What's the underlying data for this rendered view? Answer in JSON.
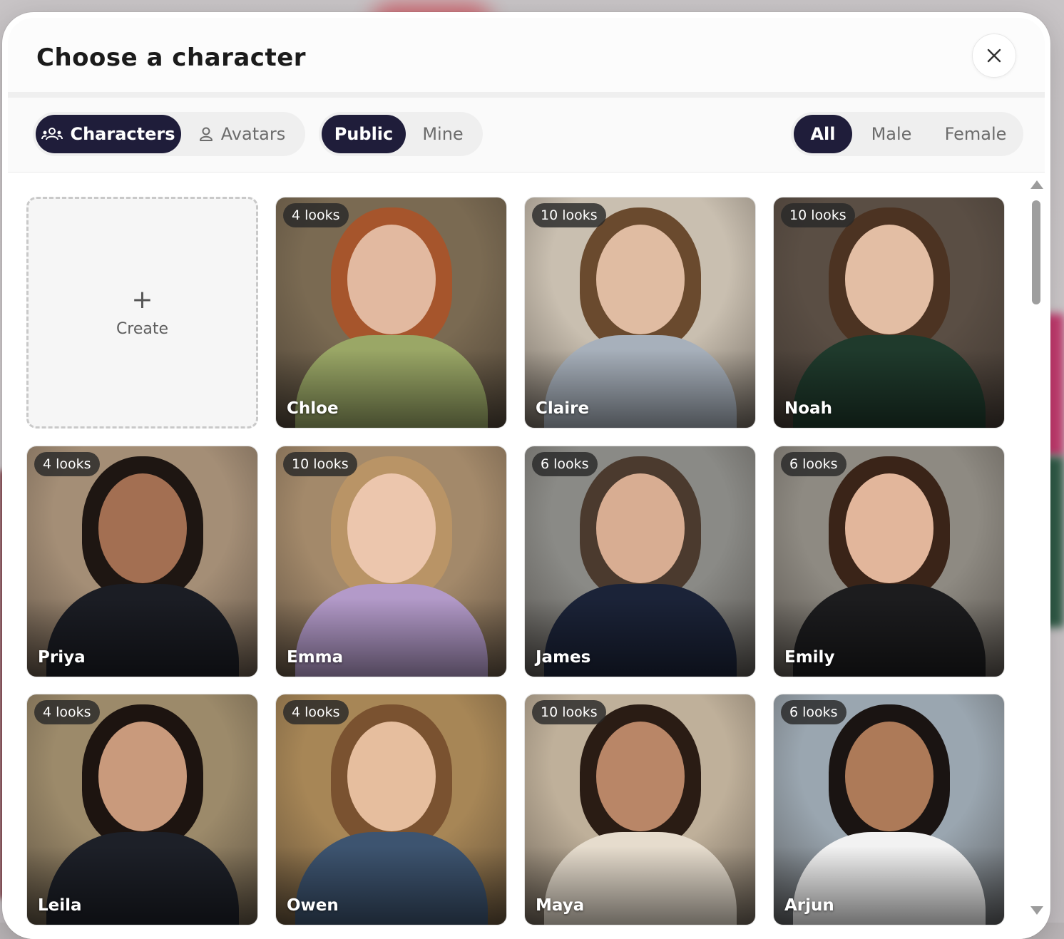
{
  "dialog": {
    "title": "Choose a character",
    "close_icon": "close-icon"
  },
  "type_tabs": [
    {
      "label": "Characters",
      "icon": "group-icon",
      "active": true
    },
    {
      "label": "Avatars",
      "icon": "person-icon",
      "active": false
    }
  ],
  "visibility_tabs": [
    {
      "label": "Public",
      "active": true
    },
    {
      "label": "Mine",
      "active": false
    }
  ],
  "gender_tabs": [
    {
      "label": "All",
      "active": true
    },
    {
      "label": "Male",
      "active": false
    },
    {
      "label": "Female",
      "active": false
    }
  ],
  "create_card": {
    "label": "Create",
    "icon": "plus-icon",
    "plus_glyph": "+"
  },
  "characters": [
    {
      "name": "Chloe",
      "looks": "4 looks",
      "bg": "#7a6a52",
      "skin": "#e2b9a0",
      "hair": "#a6552c",
      "top": "#9aa766"
    },
    {
      "name": "Claire",
      "looks": "10 looks",
      "bg": "#c9bfb0",
      "skin": "#e0bca2",
      "hair": "#6a4a2e",
      "top": "#a7b0bb"
    },
    {
      "name": "Noah",
      "looks": "10 looks",
      "bg": "#5a4e44",
      "skin": "#e3bea4",
      "hair": "#4c3322",
      "top": "#1f3a2c"
    },
    {
      "name": "Priya",
      "looks": "4 looks",
      "bg": "#a48e76",
      "skin": "#a36f52",
      "hair": "#1e1612",
      "top": "#1b1d24"
    },
    {
      "name": "Emma",
      "looks": "10 looks",
      "bg": "#a3896a",
      "skin": "#ecc6ad",
      "hair": "#b99466",
      "top": "#b39ac9"
    },
    {
      "name": "James",
      "looks": "6 looks",
      "bg": "#8a8a86",
      "skin": "#d8ad92",
      "hair": "#4b3a2e",
      "top": "#1b2338"
    },
    {
      "name": "Emily",
      "looks": "6 looks",
      "bg": "#8e8a82",
      "skin": "#e2b69b",
      "hair": "#3a2418",
      "top": "#1c1c1e"
    },
    {
      "name": "Leila",
      "looks": "4 looks",
      "bg": "#9c8a6a",
      "skin": "#c99a7c",
      "hair": "#1d1410",
      "top": "#1d2028"
    },
    {
      "name": "Owen",
      "looks": "4 looks",
      "bg": "#a78656",
      "skin": "#e6be9e",
      "hair": "#7a5230",
      "top": "#3d5470"
    },
    {
      "name": "Maya",
      "looks": "10 looks",
      "bg": "#bfb09a",
      "skin": "#b98667",
      "hair": "#2a1c14",
      "top": "#e6dccd"
    },
    {
      "name": "Arjun",
      "looks": "6 looks",
      "bg": "#9aa6b0",
      "skin": "#ad7a58",
      "hair": "#1a1412",
      "top": "#f2f2f2"
    }
  ],
  "colors": {
    "accent": "#1f1d3a",
    "pill_bg": "#efefef",
    "badge_bg": "#333333"
  }
}
